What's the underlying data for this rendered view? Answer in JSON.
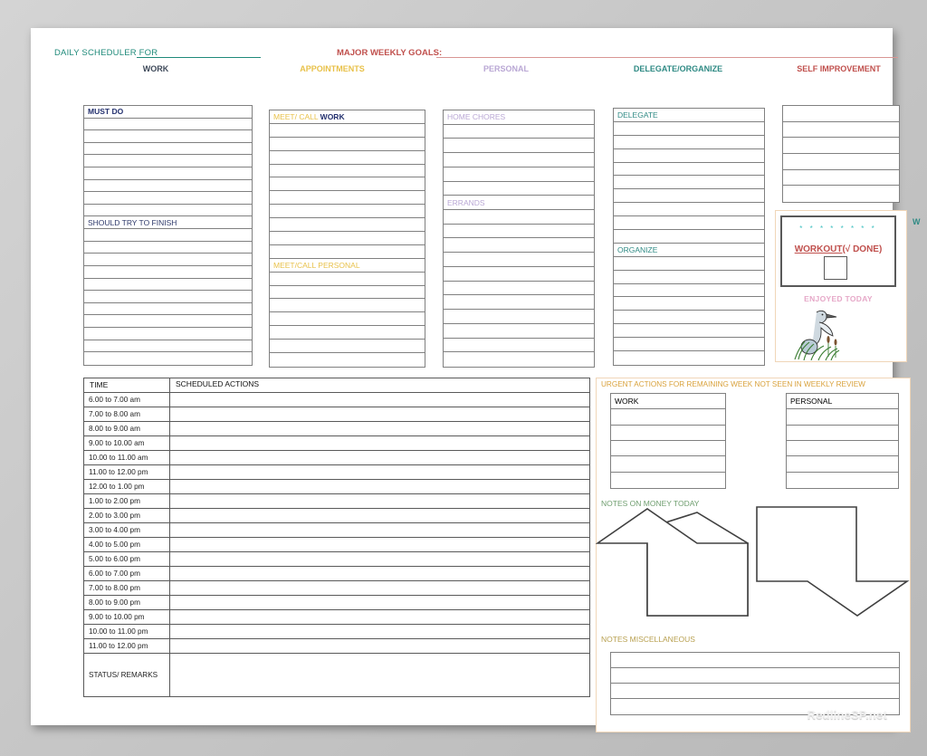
{
  "watermark": "RedlineSP.net",
  "header": {
    "title": "DAILY SCHEDULER FOR",
    "goals": "MAJOR WEEKLY GOALS:",
    "columns": [
      {
        "key": "work",
        "label": "WORK",
        "color": "#3f4a5a"
      },
      {
        "key": "appts",
        "label": "APPOINTMENTS",
        "color": "#e8c14a"
      },
      {
        "key": "personal",
        "label": "PERSONAL",
        "color": "#b9a7d4"
      },
      {
        "key": "delegate",
        "label": "DELEGATE/ORGANIZE",
        "color": "#2f8a84"
      },
      {
        "key": "self",
        "label": "SELF IMPROVEMENT",
        "color": "#c0504d"
      }
    ]
  },
  "work_column": {
    "must_do_label": "MUST DO",
    "should_try_label": "SHOULD TRY TO FINISH",
    "must_do_rows": 9,
    "should_try_rows": 12
  },
  "appointments_column": {
    "meet_call_work_prefix": "MEET/ CALL",
    "meet_call_work_suffix": "WORK",
    "meet_call_personal_label": "MEET/CALL PERSONAL",
    "work_rows": 11,
    "personal_rows": 8
  },
  "personal_column": {
    "home_chores_label": "HOME CHORES",
    "errands_label": "ERRANDS",
    "home_chores_rows": 6,
    "errands_rows": 12
  },
  "delegate_column": {
    "delegate_label": "DELEGATE",
    "organize_label": "ORGANIZE",
    "delegate_rows": 10,
    "organize_rows": 9
  },
  "self_improvement": {
    "rows": 6
  },
  "workout": {
    "stars": "* * * * * * * *",
    "label_main": "WORKOUT",
    "label_suffix": "(√ DONE)",
    "enjoyed_label": "ENJOYED TODAY",
    "edge_letter": "W",
    "star_color": "#3fc0c0",
    "label_color": "#c0504d",
    "enjoyed_color": "#e6a8c8"
  },
  "time_table": {
    "col_time": "TIME",
    "col_actions": "SCHEDULED ACTIONS",
    "status_label": "STATUS/ REMARKS",
    "slots": [
      "6.00  to 7.00 am",
      "7.00  to 8.00 am",
      "8.00  to 9.00 am",
      "9.00  to 10.00 am",
      "10.00  to 11.00 am",
      "11.00  to 12.00 pm",
      "12.00  to 1.00 pm",
      "1.00  to 2.00 pm",
      " 2.00  to 3.00 pm",
      "3.00  to 4.00 pm",
      "4.00  to 5.00 pm",
      "5.00  to 6.00 pm",
      "6.00  to 7.00 pm",
      "7.00  to 8.00 pm",
      "8.00  to 9.00 pm",
      "9.00  to 10.00 pm",
      "10.00  to 11.00 pm",
      "11.00  to 12.00 pm"
    ]
  },
  "urgent": {
    "title": "URGENT ACTIONS FOR REMAINING WEEK NOT  SEEN IN WEEKLY REVIEW",
    "work_label": "WORK",
    "personal_label": "PERSONAL",
    "work_rows": 6,
    "personal_rows": 6,
    "money_label": "NOTES ON MONEY TODAY",
    "misc_label": "NOTES MISCELLANEOUS",
    "misc_rows": 4
  }
}
